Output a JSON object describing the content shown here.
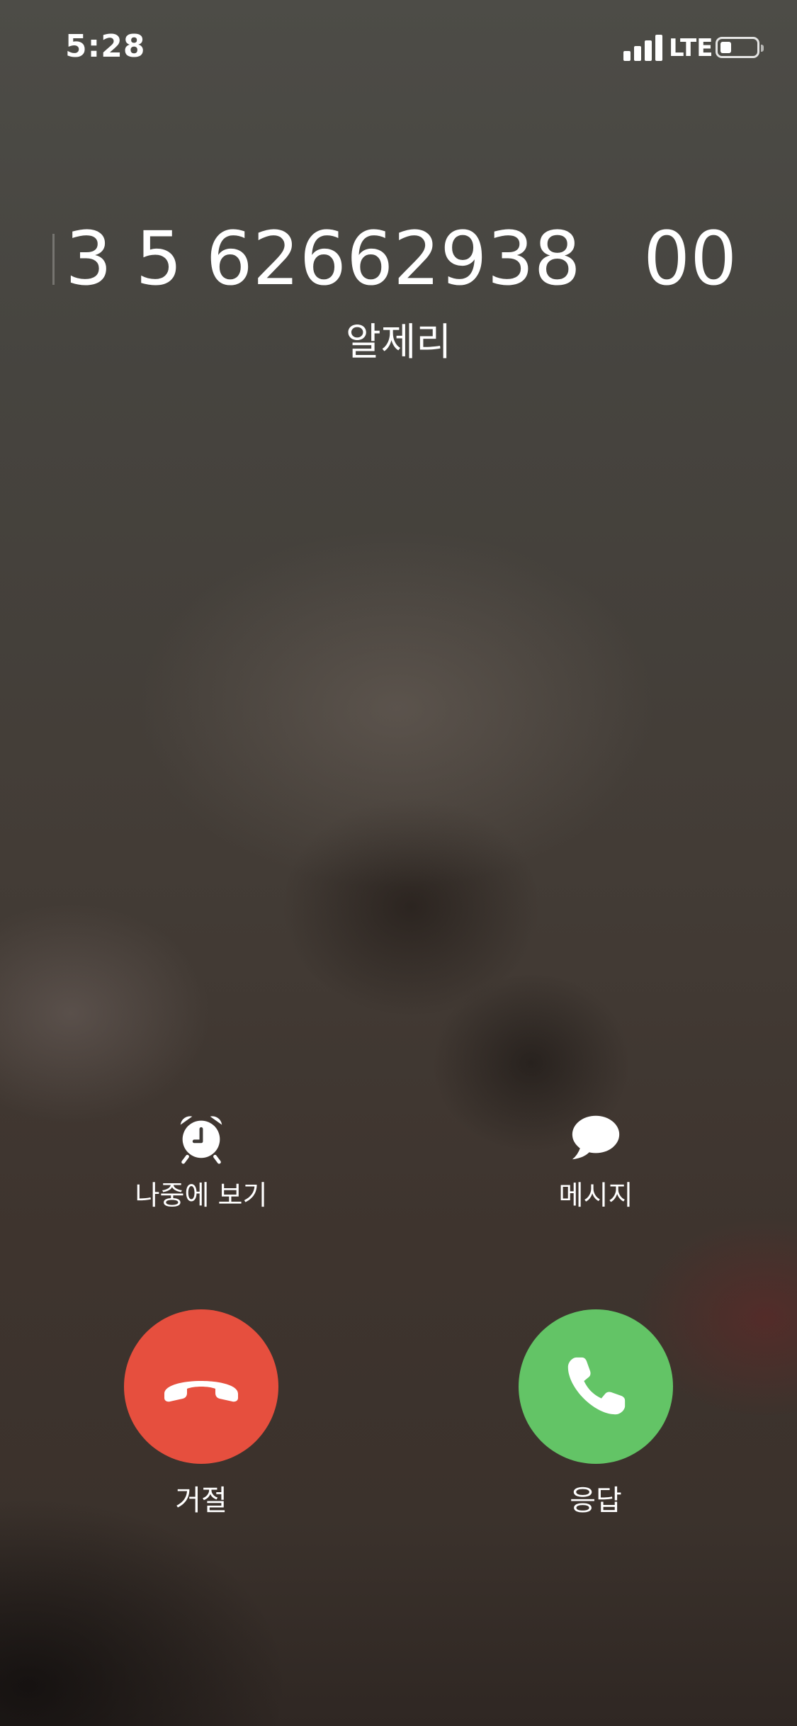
{
  "status_bar": {
    "time": "5:28",
    "network": "LTE",
    "signal_bars": 4,
    "battery_level": 0.3
  },
  "caller": {
    "number_left": "3 5 62662938",
    "number_right": "00",
    "label": "알제리"
  },
  "options": {
    "remind": {
      "label": "나중에 보기",
      "icon": "alarm-clock-icon"
    },
    "message": {
      "label": "메시지",
      "icon": "message-bubble-icon"
    }
  },
  "actions": {
    "decline": {
      "label": "거절",
      "color": "#e64f3e",
      "icon": "hang-up-icon"
    },
    "accept": {
      "label": "응답",
      "color": "#63c466",
      "icon": "phone-icon"
    }
  }
}
